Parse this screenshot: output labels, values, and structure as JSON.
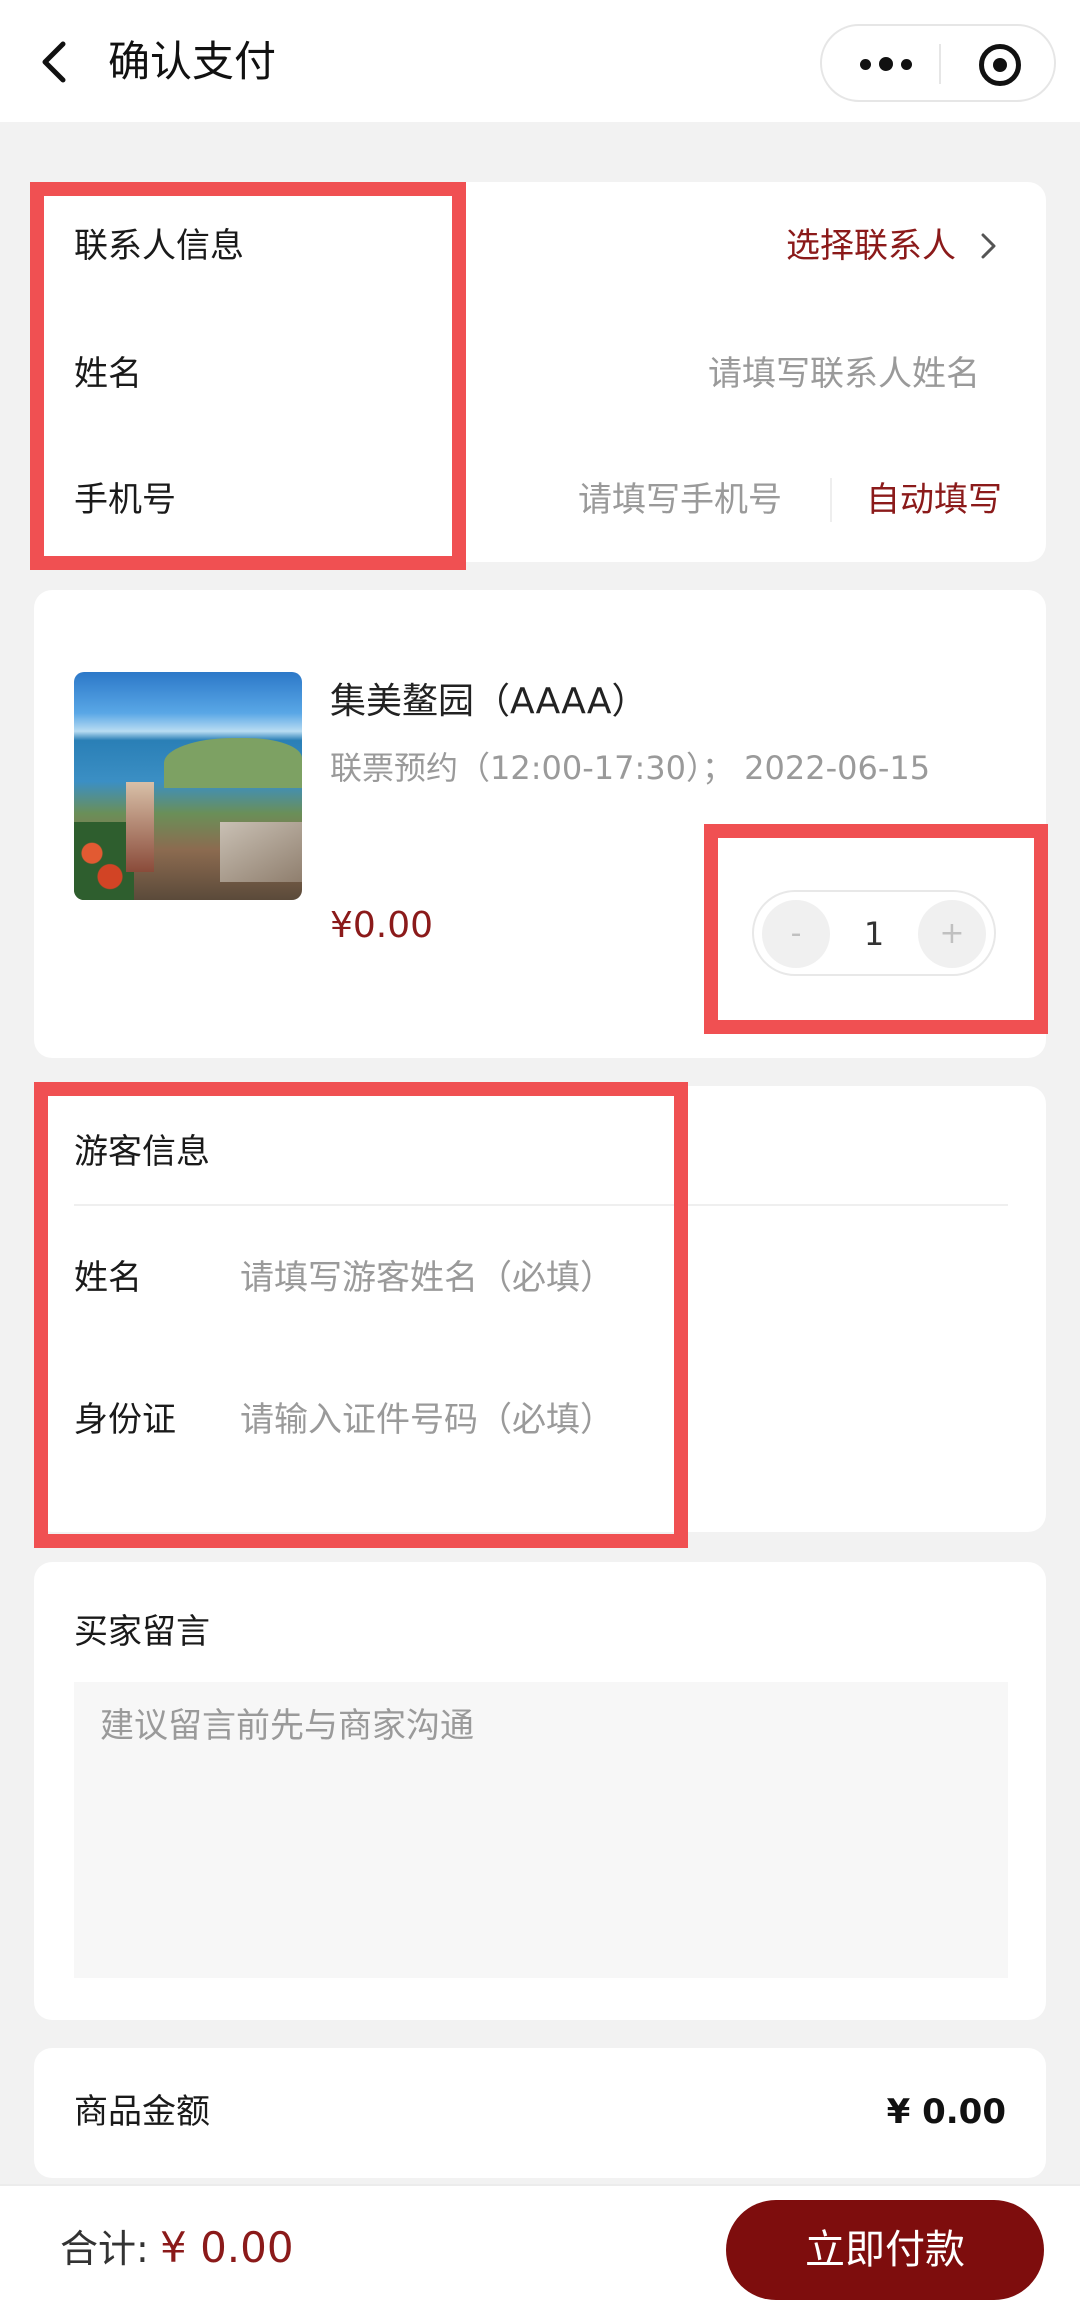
{
  "nav": {
    "title": "确认支付",
    "back_icon": "chevron-left-icon",
    "more_icon": "more-dots-icon",
    "close_icon": "target-close-icon"
  },
  "contact": {
    "section_title": "联系人信息",
    "select_link": "选择联系人",
    "name_label": "姓名",
    "name_placeholder": "请填写联系人姓名",
    "phone_label": "手机号",
    "phone_placeholder": "请填写手机号",
    "autofill_label": "自动填写"
  },
  "product": {
    "title": "集美鳌园（AAAA）",
    "subtitle": "联票预约（12:00-17:30）； 2022-06-15",
    "price": "¥0.00",
    "quantity": "1",
    "minus": "-",
    "plus": "+"
  },
  "visitor": {
    "section_title": "游客信息",
    "name_label": "姓名",
    "name_placeholder": "请填写游客姓名（必填）",
    "id_label": "身份证",
    "id_placeholder": "请输入证件号码（必填）"
  },
  "message": {
    "section_title": "买家留言",
    "placeholder": "建议留言前先与商家沟通"
  },
  "summary": {
    "amount_label": "商品金额",
    "amount_value": "¥ 0.00"
  },
  "footer": {
    "total_label": "合计:",
    "total_value": "¥ 0.00",
    "pay_button": "立即付款"
  },
  "colors": {
    "accent": "#8b1a1a",
    "pay_button": "#7e0d0d",
    "highlight": "#f05052"
  }
}
